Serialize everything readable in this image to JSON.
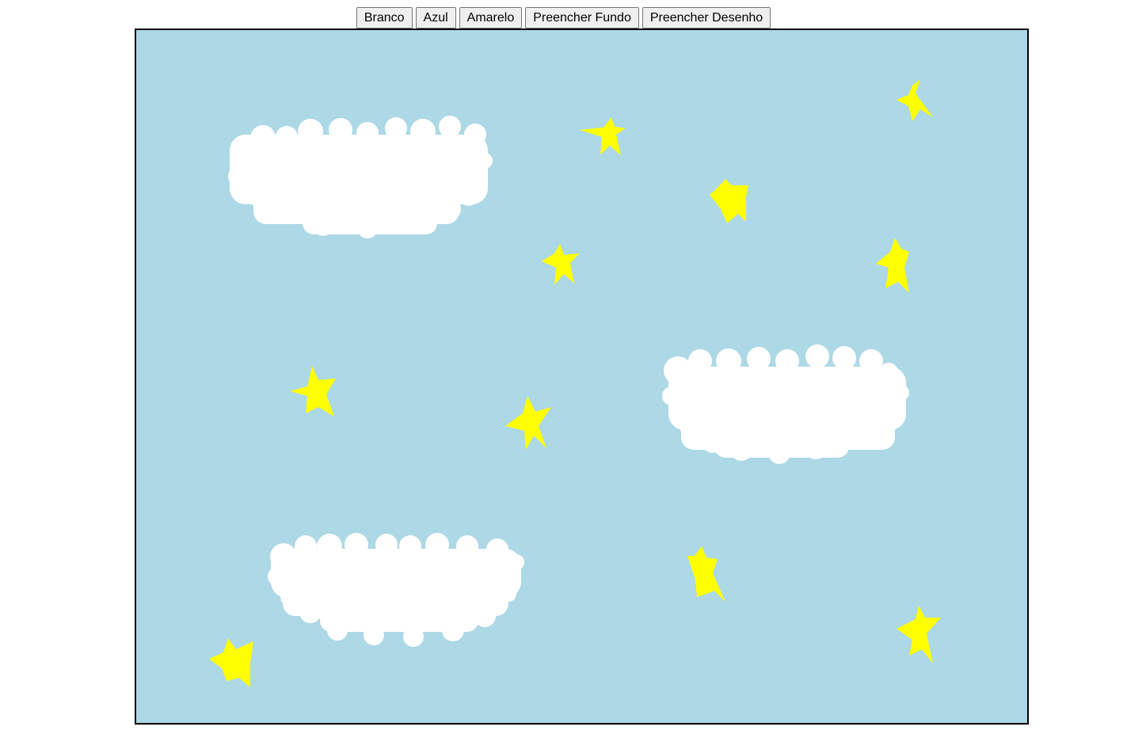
{
  "toolbar": {
    "buttons": [
      {
        "label": "Branco"
      },
      {
        "label": "Azul"
      },
      {
        "label": "Amarelo"
      },
      {
        "label": "Preencher Fundo"
      },
      {
        "label": "Preencher Desenho"
      }
    ]
  },
  "canvas": {
    "background_color": "#add8e6",
    "cloud_color": "#ffffff",
    "star_color": "#ffff00",
    "border_color": "#000000"
  }
}
